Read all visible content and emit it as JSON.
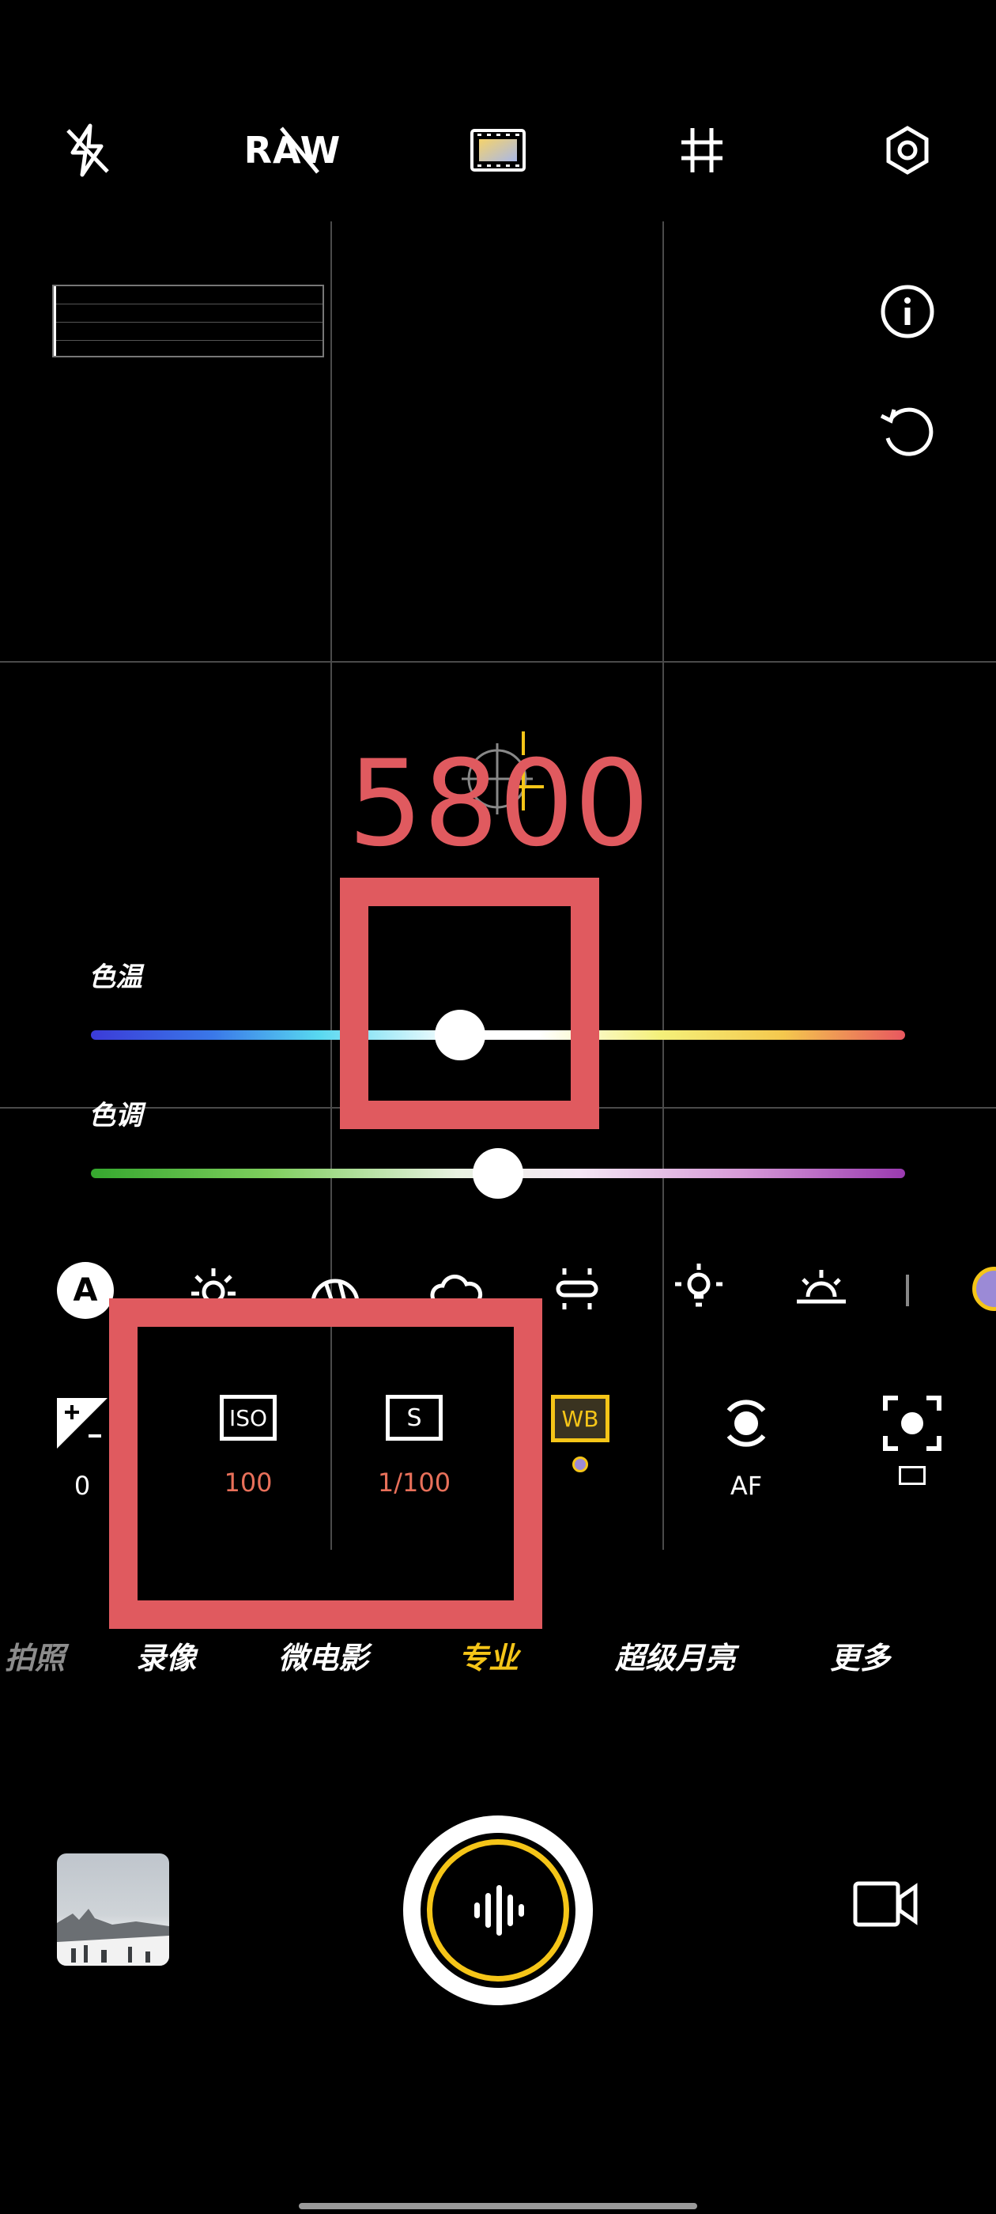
{
  "top_bar": {
    "raw_label": "RAW"
  },
  "wb_value": "5800",
  "sliders": {
    "color_temp_label": "色温",
    "color_temp_level": 0.45,
    "tint_label": "色调",
    "tint_level": 0.5
  },
  "wb_presets": {
    "auto_label": "A"
  },
  "params": {
    "exposure_value": "0",
    "iso_label": "ISO",
    "iso_value": "100",
    "shutter_label": "S",
    "shutter_value": "1/100",
    "wb_label": "WB",
    "focus_value": "AF"
  },
  "modes": [
    "拍照",
    "录像",
    "微电影",
    "专业",
    "超级月亮",
    "更多"
  ],
  "active_mode": "专业",
  "colors": {
    "accent": "#f5c518",
    "param_value": "#e8705a",
    "highlight": "#e05a5f"
  }
}
